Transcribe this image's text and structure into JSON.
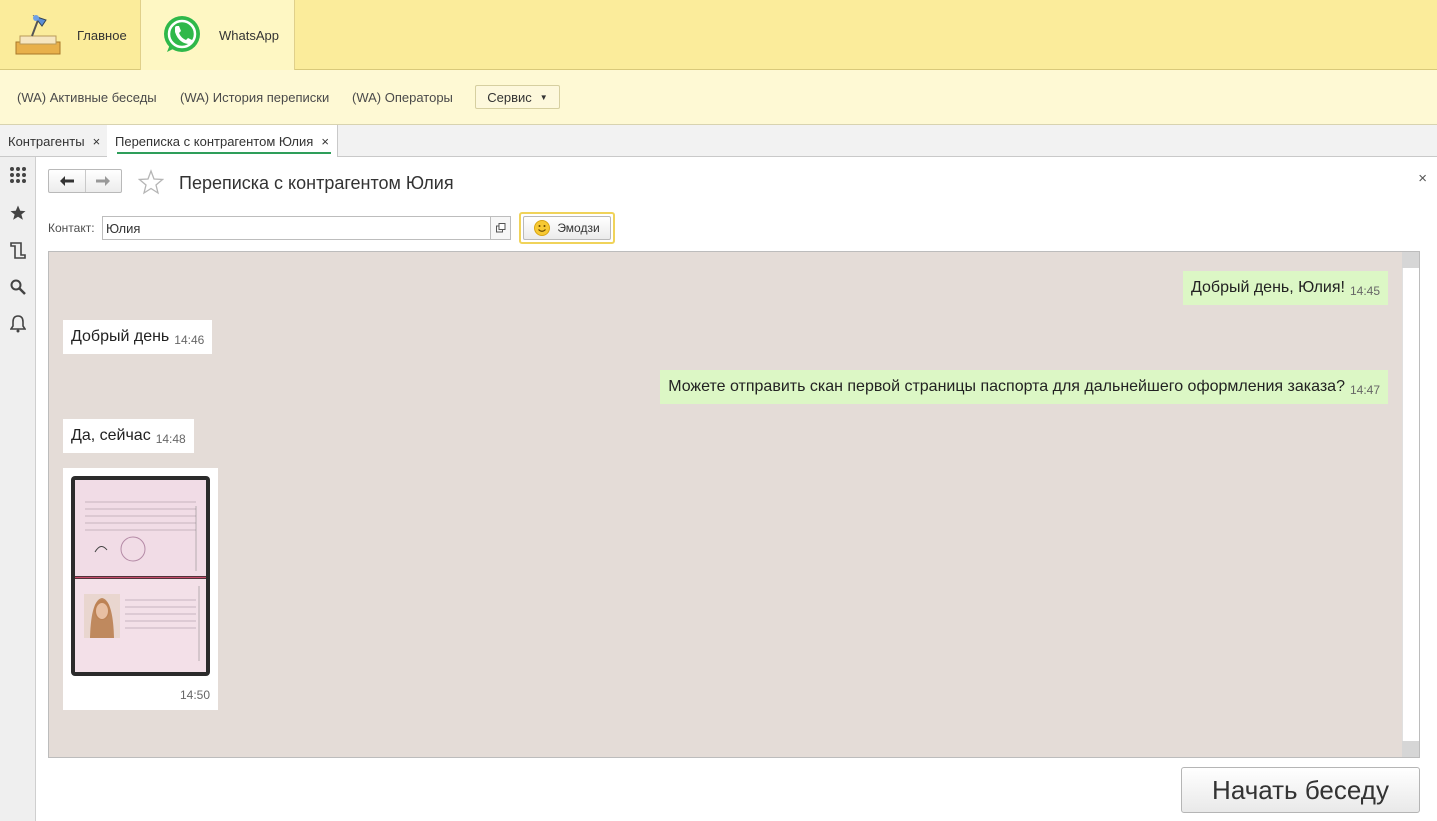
{
  "sections": {
    "home_label": "Главное",
    "whatsapp_label": "WhatsApp"
  },
  "functions": {
    "links": [
      "(WA) Активные беседы",
      "(WA) История переписки",
      "(WA) Операторы"
    ],
    "service_label": "Сервис"
  },
  "tabs": [
    {
      "label": "Контрагенты",
      "close": "×"
    },
    {
      "label": "Переписка с контрагентом Юлия",
      "close": "×"
    }
  ],
  "form": {
    "title": "Переписка с контрагентом Юлия",
    "contact_label": "Контакт:",
    "contact_value": "Юлия",
    "emoji_label": "Эмодзи",
    "close": "×"
  },
  "messages": [
    {
      "direction": "out",
      "text": "Добрый день, Юлия!",
      "time": "14:45"
    },
    {
      "direction": "in",
      "text": "Добрый день",
      "time": "14:46"
    },
    {
      "direction": "out",
      "text": "Можете отправить скан первой страницы паспорта для дальнейшего оформления заказа?",
      "time": "14:47"
    },
    {
      "direction": "in",
      "text": "Да, сейчас",
      "time": "14:48"
    },
    {
      "direction": "in",
      "type": "image",
      "image": "passport-scan",
      "time": "14:50"
    }
  ],
  "start_button_label": "Начать беседу",
  "colors": {
    "section_bar": "#fbec9b",
    "function_bar": "#fef9d4",
    "chat_background": "#e4dcd7",
    "outgoing_bubble": "#dcf7c5",
    "incoming_bubble": "#ffffff",
    "active_tab_underline": "#2e9e5a"
  },
  "icons": {
    "left_toolbar": [
      "apps-grid-icon",
      "favorites-star-icon",
      "history-icon",
      "search-icon",
      "notifications-bell-icon"
    ]
  }
}
